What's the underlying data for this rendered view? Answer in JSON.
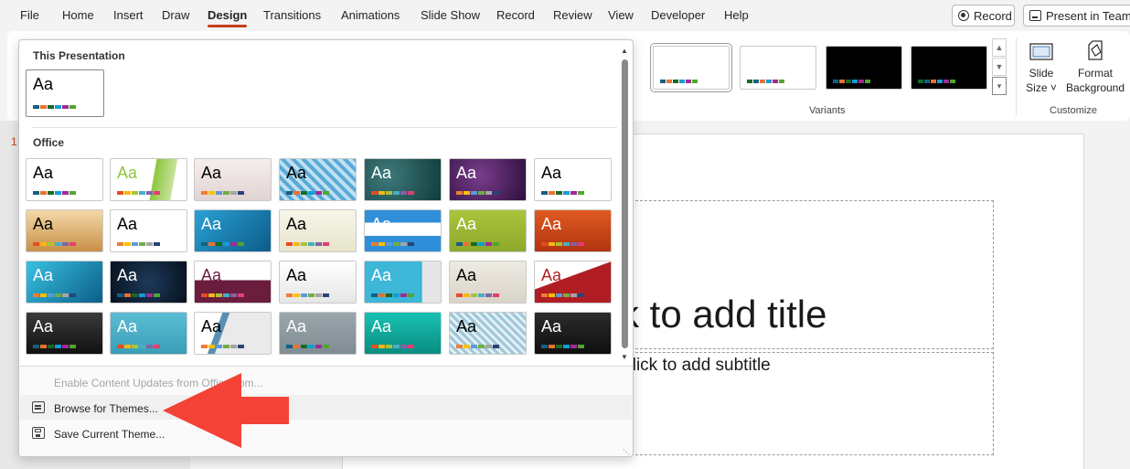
{
  "tabs": [
    "File",
    "Home",
    "Insert",
    "Draw",
    "Design",
    "Transitions",
    "Animations",
    "Slide Show",
    "Record",
    "Review",
    "View",
    "Developer",
    "Help"
  ],
  "active_tab": "Design",
  "header_buttons": {
    "record": "Record",
    "present": "Present in Teams"
  },
  "ribbon": {
    "variants_label": "Variants",
    "customize_label": "Customize",
    "slide_size": {
      "line1": "Slide",
      "line2": "Size ˅"
    },
    "format_background": {
      "line1": "Format",
      "line2": "Background"
    }
  },
  "slide": {
    "title_placeholder": "k to add title",
    "subtitle_placeholder": "Click to add subtitle",
    "slide_number": "1"
  },
  "gallery": {
    "this_presentation_label": "This Presentation",
    "office_label": "Office",
    "theme_glyph": "Aa"
  },
  "menu": {
    "enable_updates": "Enable Content Updates from Office.com...",
    "browse_themes": "Browse for Themes...",
    "save_theme": "Save Current Theme..."
  },
  "colors": {
    "accent": "#c43e1c",
    "arrow": "#f44336"
  }
}
